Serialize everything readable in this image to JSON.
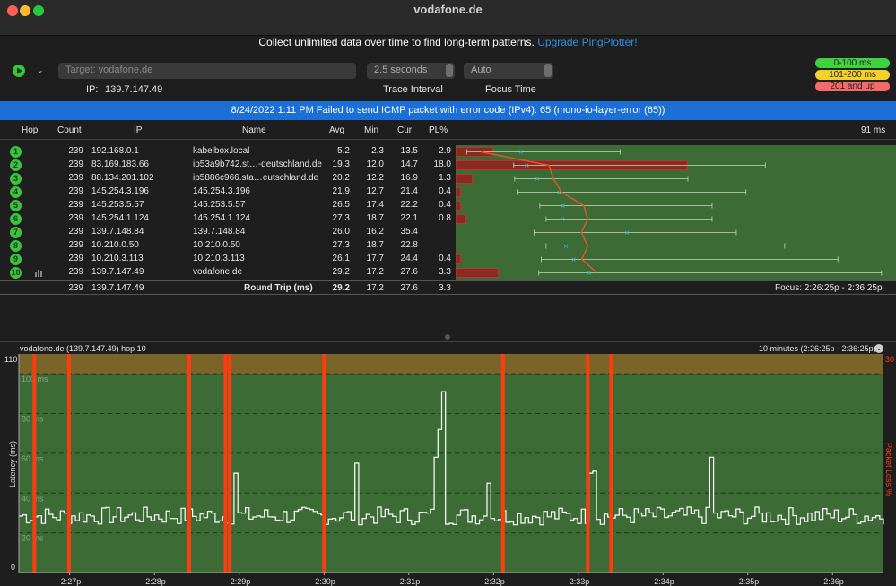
{
  "window": {
    "title": "vodafone.de"
  },
  "promo": {
    "text": "Collect unlimited data over time to find long-term patterns.",
    "link": "Upgrade PingPlotter!"
  },
  "toolbar": {
    "target_placeholder": "Target:  vodafone.de",
    "ip_label": "IP:",
    "ip_value": "139.7.147.49",
    "interval_value": "2.5 seconds",
    "interval_label": "Trace Interval",
    "focus_value": "Auto",
    "focus_label": "Focus Time"
  },
  "legend": [
    {
      "label": "0-100 ms",
      "color": "#3ed23e"
    },
    {
      "label": "101-200 ms",
      "color": "#f2d22a"
    },
    {
      "label": "201 and up",
      "color": "#f26a6a"
    }
  ],
  "error_bar": "8/24/2022 1:11 PM Failed to send ICMP packet with error code (IPv4): 65 (mono-io-layer-error (65))",
  "table": {
    "headers": {
      "hop": "Hop",
      "count": "Count",
      "ip": "IP",
      "name": "Name",
      "avg": "Avg",
      "min": "Min",
      "cur": "Cur",
      "pl": "PL%",
      "scale": "91 ms"
    },
    "rows": [
      {
        "hop": "1",
        "count": "239",
        "ip": "192.168.0.1",
        "name": "kabelbox.local",
        "avg": "5.2",
        "min": "2.3",
        "cur": "13.5",
        "pl": "2.9",
        "plv": 2.9,
        "minv": 2.3,
        "avgv": 5.2,
        "curv": 13.5,
        "maxv": 34
      },
      {
        "hop": "2",
        "count": "239",
        "ip": "83.169.183.66",
        "name": "ip53a9b742.st…-deutschland.de",
        "avg": "19.3",
        "min": "12.0",
        "cur": "14.7",
        "pl": "18.0",
        "plv": 18.0,
        "minv": 12.0,
        "avgv": 19.3,
        "curv": 14.7,
        "maxv": 64
      },
      {
        "hop": "3",
        "count": "239",
        "ip": "88.134.201.102",
        "name": "ip5886c966.sta…eutschland.de",
        "avg": "20.2",
        "min": "12.2",
        "cur": "16.9",
        "pl": "1.3",
        "plv": 1.3,
        "minv": 12.2,
        "avgv": 20.2,
        "curv": 16.9,
        "maxv": 48
      },
      {
        "hop": "4",
        "count": "239",
        "ip": "145.254.3.196",
        "name": "145.254.3.196",
        "avg": "21.9",
        "min": "12.7",
        "cur": "21.4",
        "pl": "0.4",
        "plv": 0.4,
        "minv": 12.7,
        "avgv": 21.9,
        "curv": 21.4,
        "maxv": 60
      },
      {
        "hop": "5",
        "count": "239",
        "ip": "145.253.5.57",
        "name": "145.253.5.57",
        "avg": "26.5",
        "min": "17.4",
        "cur": "22.2",
        "pl": "0.4",
        "plv": 0.4,
        "minv": 17.4,
        "avgv": 26.5,
        "curv": 22.2,
        "maxv": 53
      },
      {
        "hop": "6",
        "count": "239",
        "ip": "145.254.1.124",
        "name": "145.254.1.124",
        "avg": "27.3",
        "min": "18.7",
        "cur": "22.1",
        "pl": "0.8",
        "plv": 0.8,
        "minv": 18.7,
        "avgv": 27.3,
        "curv": 22.1,
        "maxv": 53
      },
      {
        "hop": "7",
        "count": "239",
        "ip": "139.7.148.84",
        "name": "139.7.148.84",
        "avg": "26.0",
        "min": "16.2",
        "cur": "35.4",
        "pl": "",
        "plv": 0,
        "minv": 16.2,
        "avgv": 26.0,
        "curv": 35.4,
        "maxv": 58
      },
      {
        "hop": "8",
        "count": "239",
        "ip": "10.210.0.50",
        "name": "10.210.0.50",
        "avg": "27.3",
        "min": "18.7",
        "cur": "22.8",
        "pl": "",
        "plv": 0,
        "minv": 18.7,
        "avgv": 27.3,
        "curv": 22.8,
        "maxv": 68
      },
      {
        "hop": "9",
        "count": "239",
        "ip": "10.210.3.113",
        "name": "10.210.3.113",
        "avg": "26.1",
        "min": "17.7",
        "cur": "24.4",
        "pl": "0.4",
        "plv": 0.4,
        "minv": 17.7,
        "avgv": 26.1,
        "curv": 24.4,
        "maxv": 79
      },
      {
        "hop": "10",
        "count": "239",
        "ip": "139.7.147.49",
        "name": "vodafone.de",
        "avg": "29.2",
        "min": "17.2",
        "cur": "27.6",
        "pl": "3.3",
        "plv": 3.3,
        "minv": 17.2,
        "avgv": 29.2,
        "curv": 27.6,
        "maxv": 88
      }
    ],
    "summary": {
      "count": "239",
      "ip": "139.7.147.49",
      "name": "Round Trip (ms)",
      "avg": "29.2",
      "min": "17.2",
      "cur": "27.6",
      "pl": "3.3",
      "focus": "Focus: 2:26:25p - 2:36:25p"
    }
  },
  "graph": {
    "title": "vodafone.de (139.7.147.49) hop 10",
    "range": "10 minutes (2:26:25p - 2:36:25p)"
  },
  "chart_data": {
    "type": "line",
    "ylabel": "Latency (ms)",
    "y2label": "Packet Loss %",
    "ylim": [
      0,
      110
    ],
    "y2max": "30",
    "ytick_top": "110",
    "ytick_bottom": "0",
    "y_gridlines": [
      {
        "value": 100,
        "label": "100 ms"
      },
      {
        "value": 80,
        "label": "80 ms"
      },
      {
        "value": 60,
        "label": "60 ms"
      },
      {
        "value": 40,
        "label": "40 ms"
      },
      {
        "value": 20,
        "label": "20 ms"
      }
    ],
    "xtick_labels": [
      "2:27p",
      "2:28p",
      "2:29p",
      "2:30p",
      "2:31p",
      "2:32p",
      "2:33p",
      "2:34p",
      "2:35p",
      "2:36p"
    ],
    "loss_markers_fraction": [
      0.018,
      0.058,
      0.197,
      0.239,
      0.244,
      0.353,
      0.56,
      0.658,
      0.685
    ],
    "spikes": [
      {
        "t": 0.49,
        "v": 91
      },
      {
        "t": 0.485,
        "v": 72
      },
      {
        "t": 0.48,
        "v": 58
      },
      {
        "t": 0.8,
        "v": 58
      },
      {
        "t": 0.39,
        "v": 55
      },
      {
        "t": 0.25,
        "v": 50
      },
      {
        "t": 0.5,
        "v": 52
      },
      {
        "t": 0.54,
        "v": 45
      },
      {
        "t": 0.66,
        "v": 50
      },
      {
        "t": 0.665,
        "v": 51
      }
    ]
  }
}
